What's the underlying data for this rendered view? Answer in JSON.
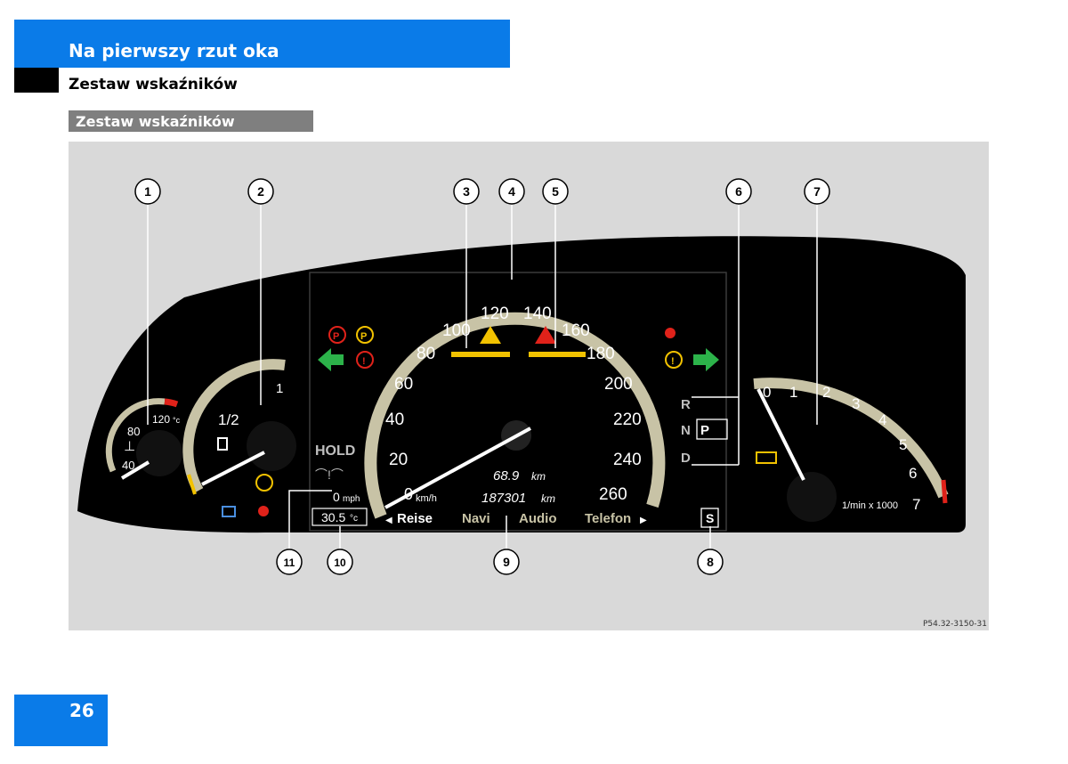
{
  "header": {
    "title": "Na pierwszy rzut oka",
    "subtitle": "Zestaw wskaźników"
  },
  "section": {
    "label": "Zestaw wskaźników"
  },
  "figure": {
    "code": "P54.32-3150-31",
    "callouts": [
      "1",
      "2",
      "3",
      "4",
      "5",
      "6",
      "7",
      "8",
      "9",
      "10",
      "11"
    ],
    "coolant": {
      "ticks": [
        "40",
        "80",
        "120"
      ],
      "unit": "°c"
    },
    "fuel": {
      "ticks": [
        "1/2",
        "1"
      ]
    },
    "speedometer": {
      "ticks": [
        "20",
        "40",
        "60",
        "80",
        "100",
        "120",
        "140",
        "160",
        "180",
        "200",
        "220",
        "240",
        "260"
      ],
      "zero": "0",
      "unit": "km/h",
      "trip": "68.9",
      "trip_unit": "km",
      "odometer": "187301",
      "odometer_unit": "km"
    },
    "tachometer": {
      "ticks": [
        "0",
        "1",
        "2",
        "3",
        "4",
        "5",
        "6",
        "7"
      ],
      "unit": "1/min x 1000"
    },
    "gear": {
      "r": "R",
      "p": "P",
      "n": "N",
      "d": "D"
    },
    "hold": "HOLD",
    "mph": {
      "value": "0",
      "unit": "mph"
    },
    "temperature": {
      "value": "30.5",
      "unit": "°c"
    },
    "menu": [
      "Reise",
      "Navi",
      "Audio",
      "Telefon"
    ],
    "sport": "S",
    "colors": {
      "brand_blue": "#0a7be8",
      "cluster": "#000000",
      "arc": "#c8c3a6",
      "warning_red": "#e0221a",
      "warning_yellow": "#f2c200",
      "arrow_green": "#2cb34a"
    }
  },
  "page": {
    "number": "26"
  }
}
